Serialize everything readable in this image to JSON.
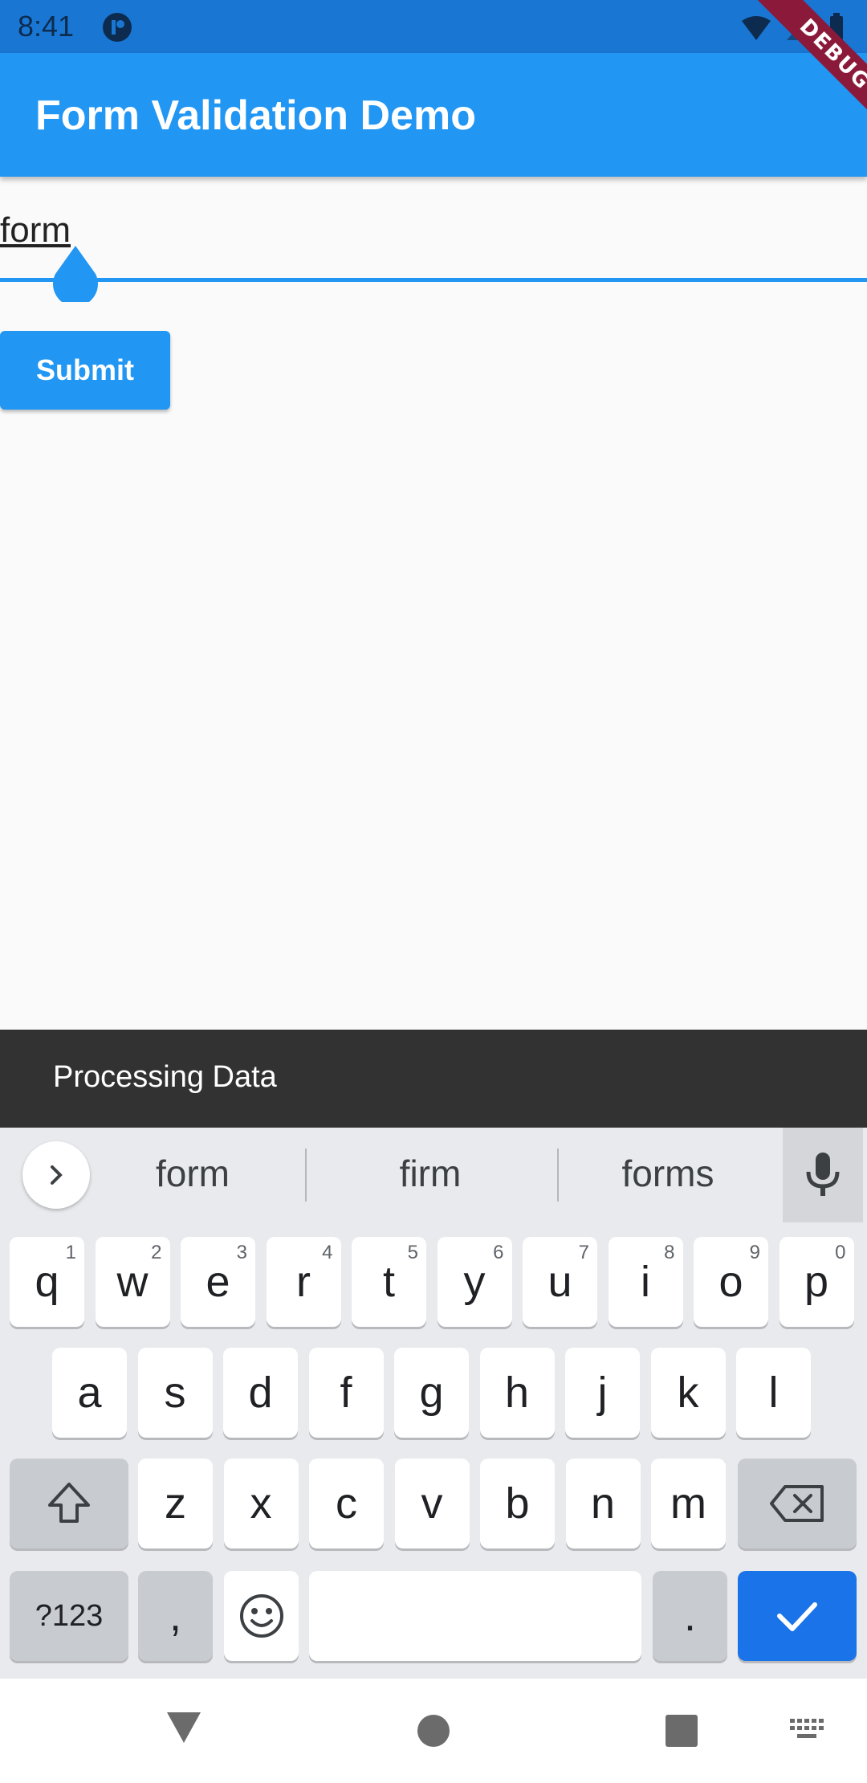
{
  "status_bar": {
    "time": "8:41"
  },
  "debug_banner": {
    "label": "DEBUG"
  },
  "app_bar": {
    "title": "Form Validation Demo"
  },
  "form": {
    "field_value": "form",
    "submit_label": "Submit"
  },
  "snackbar": {
    "text": "Processing Data"
  },
  "keyboard": {
    "suggestions": [
      "form",
      "firm",
      "forms"
    ],
    "row1": [
      {
        "key": "q",
        "hint": "1"
      },
      {
        "key": "w",
        "hint": "2"
      },
      {
        "key": "e",
        "hint": "3"
      },
      {
        "key": "r",
        "hint": "4"
      },
      {
        "key": "t",
        "hint": "5"
      },
      {
        "key": "y",
        "hint": "6"
      },
      {
        "key": "u",
        "hint": "7"
      },
      {
        "key": "i",
        "hint": "8"
      },
      {
        "key": "o",
        "hint": "9"
      },
      {
        "key": "p",
        "hint": "0"
      }
    ],
    "row2": [
      "a",
      "s",
      "d",
      "f",
      "g",
      "h",
      "j",
      "k",
      "l"
    ],
    "row3": [
      "z",
      "x",
      "c",
      "v",
      "b",
      "n",
      "m"
    ],
    "symbols_label": "?123",
    "comma_label": ",",
    "period_label": ".",
    "colors": {
      "accent": "#1a73e8",
      "app_bar": "#2196f3"
    }
  }
}
